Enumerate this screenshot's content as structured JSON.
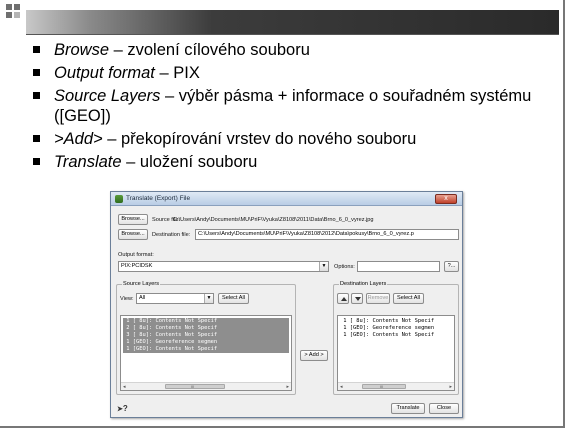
{
  "slide": {
    "bullets": [
      {
        "term": "Browse",
        "rest": " – zvolení cílového souboru"
      },
      {
        "term": "Output format",
        "rest": " – PIX"
      },
      {
        "term": "Source Layers",
        "rest": " – výběr pásma + informace o souřadném systému ([GEO])"
      },
      {
        "term": ">Add>",
        "rest": " – překopírování vrstev do nového souboru"
      },
      {
        "term": "Translate",
        "rest": " – uložení souboru"
      }
    ]
  },
  "dialog": {
    "title": "Translate (Export) File",
    "close_glyph": "x",
    "browse_label": "Browse...",
    "source_file_label": "Source file:",
    "source_file_path": "C:\\Users\\Andy\\Documents\\MU\\PriF\\Vyuka\\Z8108\\2011\\Data\\Brno_6_0_vyrez.jpg",
    "dest_file_label": "Destination file:",
    "dest_file_path": "C:\\Users\\Andy\\Documents\\MU\\PriF\\Vyuka\\Z8108\\2012\\Data\\pokusy\\Brno_6_0_vyrez.p",
    "output_format_label": "Output format:",
    "output_format_value": "PIX:PCIDSK",
    "options_label": "Options:",
    "options_value": "",
    "options_button": "?...",
    "source_layers": {
      "title": "Source Layers",
      "view_label": "View:",
      "view_value": "All",
      "select_all": "Select All",
      "items": [
        " 1 [ 8u]: Contents Not Specif",
        " 2 [ 8u]: Contents Not Specif",
        " 3 [ 8u]: Contents Not Specif",
        " 1 [GEO]: Georeference segmen",
        " 1 [GEO]: Contents Not Specif"
      ]
    },
    "add_button": "> Add >",
    "destination_layers": {
      "title": "Destination Layers",
      "remove": "Remove",
      "select_all": "Select All",
      "items": [
        " 1 [ 8u]: Contents Not Specif",
        " 1 [GEO]: Georeference segmen",
        " 1 [GEO]: Contents Not Specif"
      ]
    },
    "scroll_thumb_label": "III",
    "help_glyph": "?",
    "translate_button": "Translate",
    "close_button": "Close"
  }
}
